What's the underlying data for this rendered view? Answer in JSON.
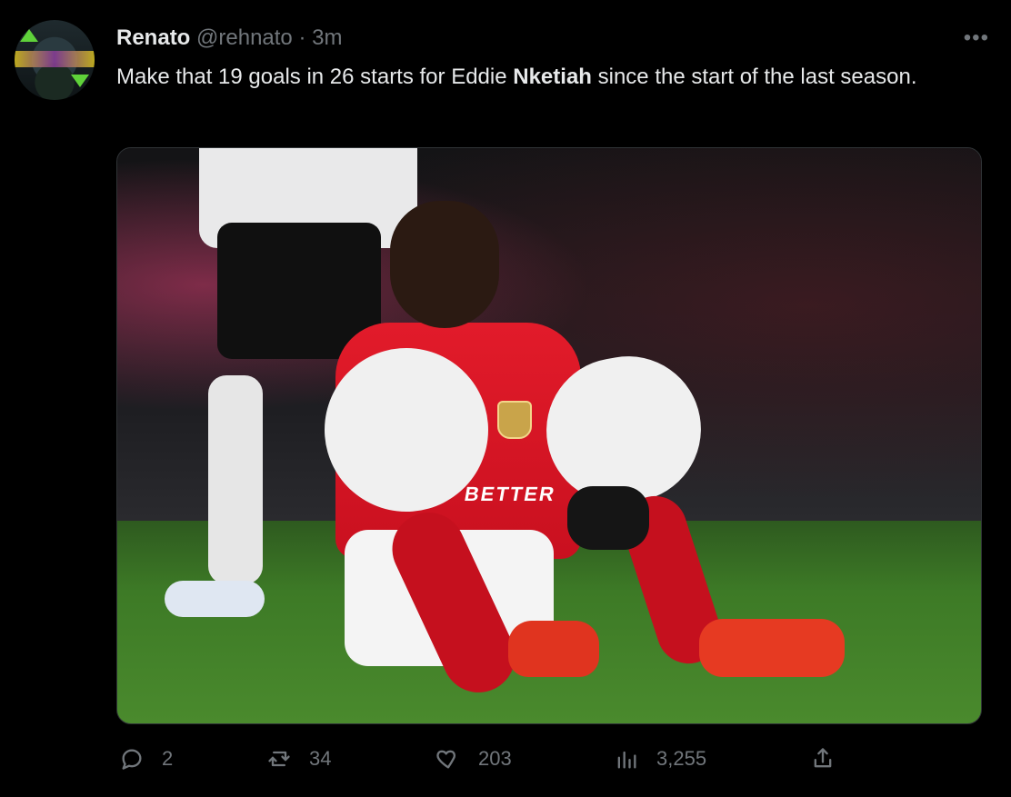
{
  "tweet": {
    "author_name": "Renato",
    "author_handle": "@rehnato",
    "separator": "·",
    "time": "3m",
    "text_before": "Make that 19 goals in 26 starts for Eddie ",
    "text_bold": "Nketiah",
    "text_after": " since the start of the last season.",
    "more_label": "•••",
    "media": {
      "shirt_text": "BETTER"
    },
    "stats": {
      "replies": "2",
      "retweets": "34",
      "likes": "203",
      "views": "3,255"
    },
    "icons": {
      "reply": "reply-icon",
      "retweet": "retweet-icon",
      "like": "heart-icon",
      "views": "views-icon",
      "share": "share-icon"
    }
  }
}
